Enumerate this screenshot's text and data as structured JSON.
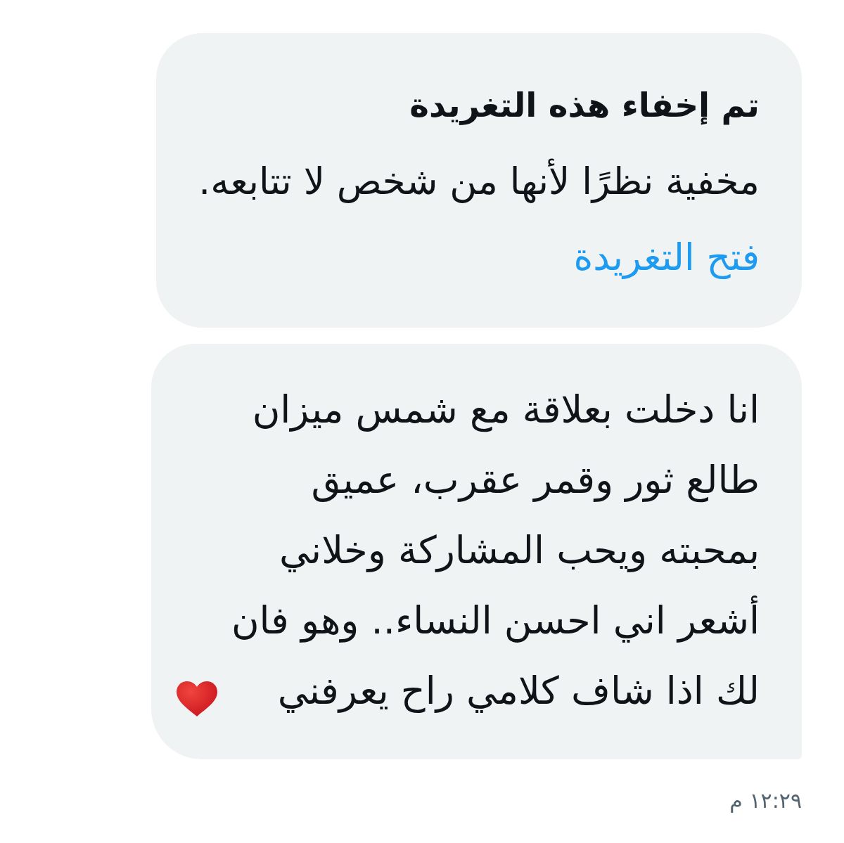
{
  "messages": [
    {
      "kind": "hidden_tweet",
      "title": "تم إخفاء هذه التغريدة",
      "text": "مخفية نظرًا لأنها من شخص لا تتابعه.",
      "link": "فتح التغريدة"
    },
    {
      "kind": "text",
      "text": "انا دخلت بعلاقة مع شمس ميزان طالع ثور وقمر عقرب، عميق بمحبته ويحب المشاركة وخلاني أشعر اني احسن النساء.. وهو فان لك اذا شاف كلامي راح يعرفني"
    }
  ],
  "timestamp": "١٢:٢٩ م"
}
